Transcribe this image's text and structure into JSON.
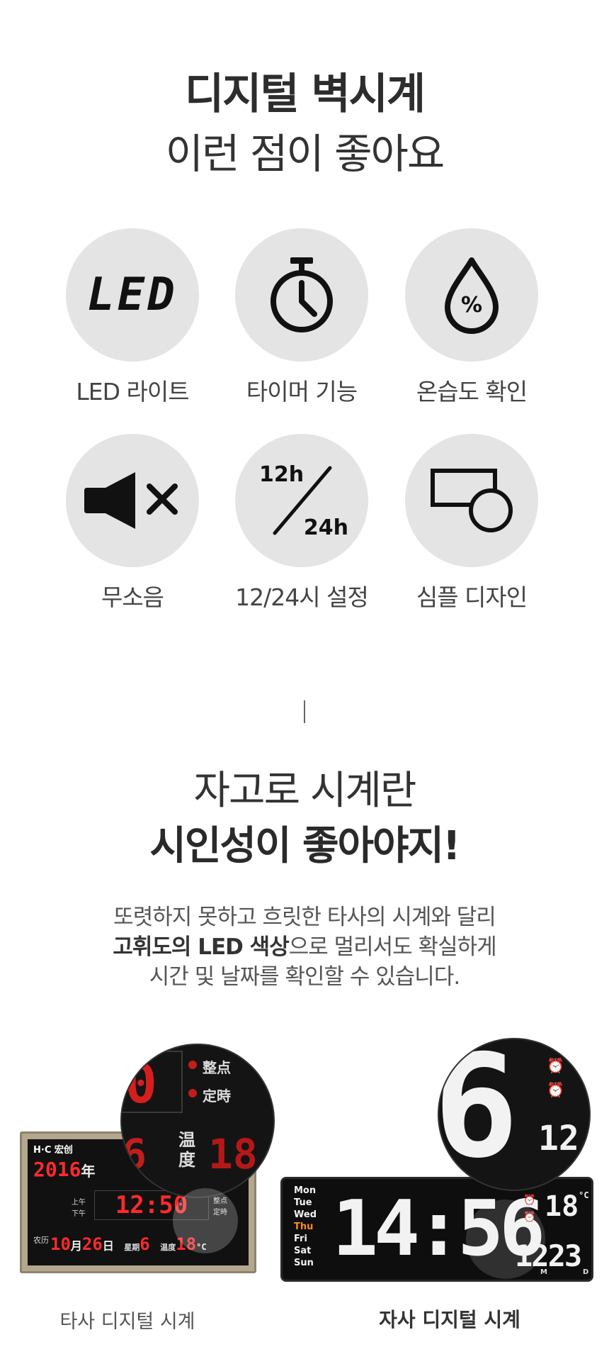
{
  "header": {
    "title": "디지털 벽시계",
    "subtitle": "이런 점이 좋아요"
  },
  "features": [
    {
      "label": "LED 라이트",
      "icon": "led-icon",
      "icon_text": "LED"
    },
    {
      "label": "타이머 기능",
      "icon": "stopwatch-icon"
    },
    {
      "label": "온습도 확인",
      "icon": "humidity-drop-icon",
      "icon_text": "%"
    },
    {
      "label": "무소음",
      "icon": "speaker-mute-icon"
    },
    {
      "label": "12/24시 설정",
      "icon": "hour-format-icon",
      "icon_text_a": "12h",
      "icon_text_b": "24h"
    },
    {
      "label": "심플 디자인",
      "icon": "simple-shapes-icon"
    }
  ],
  "section2": {
    "line1": "자고로 시계란",
    "line2": "시인성이 좋아야지!",
    "desc_line1": "또렷하지 못하고 흐릿한 타사의 시계와 달리",
    "desc_line2_bold": "고휘도의 LED 색상",
    "desc_line2_rest": "으로 멀리서도 확실하게",
    "desc_line3": "시간 및 날짜를 확인할 수 있습니다."
  },
  "comparison": {
    "left_caption": "타사 디지털 시계",
    "right_caption": "자사 디지털 시계",
    "left_clock": {
      "brand": "H·C 宏创",
      "year": "2016",
      "year_char": "年",
      "time": "12:50",
      "am": "上午",
      "pm": "下午",
      "alarm1": "整点",
      "alarm2": "定時",
      "lunar": "农历",
      "month": "10",
      "month_char": "月",
      "day": "26",
      "day_char": "日",
      "week_label": "星期",
      "week": "6",
      "temp_label": "温度",
      "temp": "18",
      "temp_unit": "°C"
    },
    "right_clock": {
      "days": [
        "Mon",
        "Tue",
        "Wed",
        "Thu",
        "Fri",
        "Sat",
        "Sun"
      ],
      "active_day": "Thu",
      "time": "14:56",
      "temp": "18",
      "temp_unit": "°C",
      "date": "1223",
      "month_mark": "M",
      "day_mark": "D",
      "zoom_digit": "6",
      "zoom_small": "12"
    },
    "colors": {
      "led_red": "#ff2a2a",
      "led_white": "#f2f2f2",
      "active_day": "#ff8c1a"
    }
  }
}
